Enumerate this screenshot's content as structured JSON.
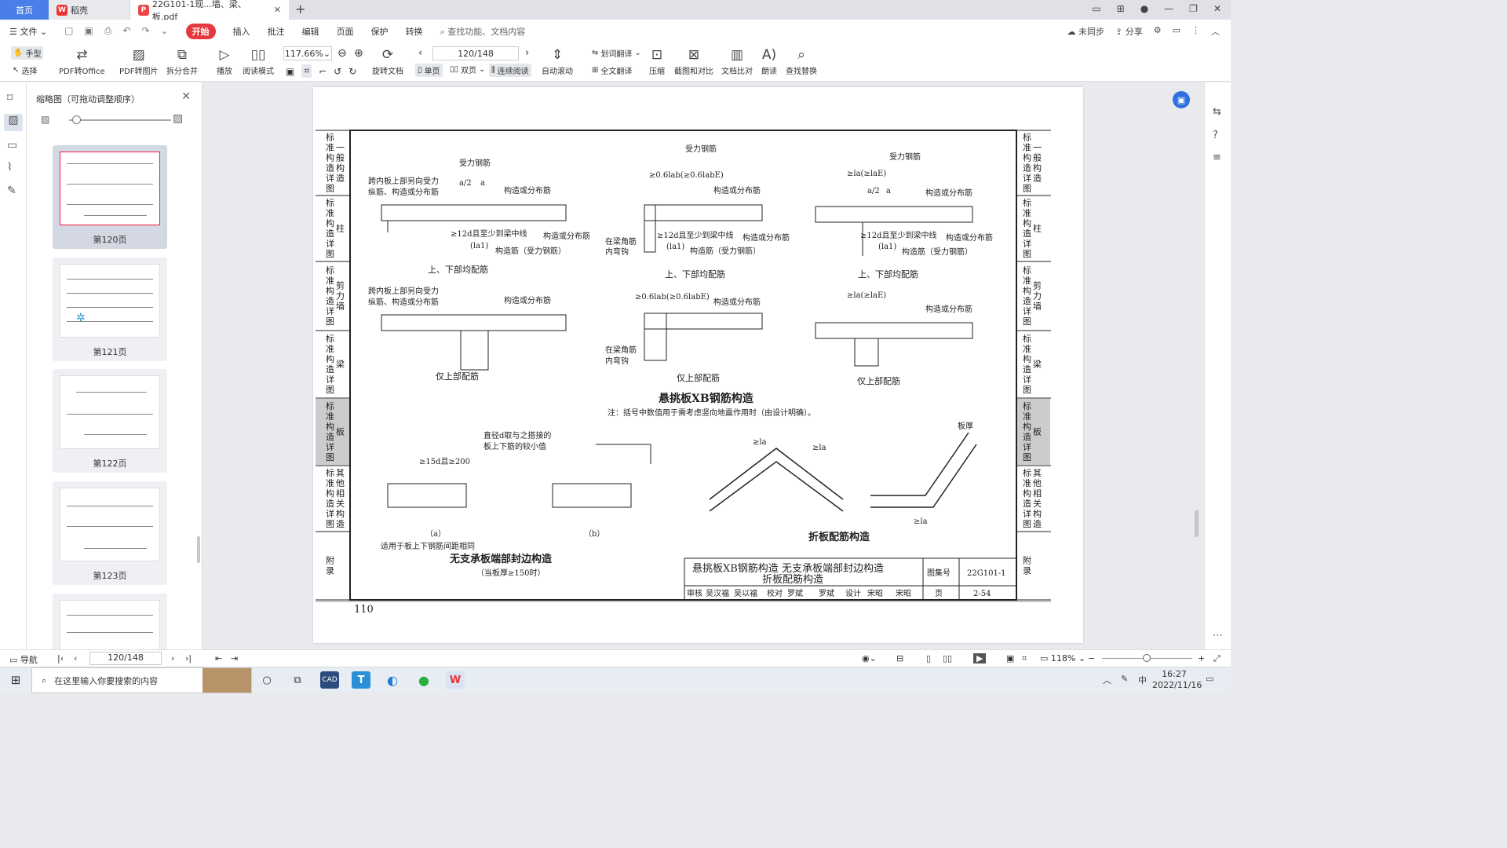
{
  "tabs": {
    "home": "首页",
    "docer": "稻壳",
    "pdf": "22G101-1现...墙、梁、板.pdf"
  },
  "menu": {
    "file": "文件",
    "start": "开始",
    "items": [
      "插入",
      "批注",
      "编辑",
      "页面",
      "保护",
      "转换"
    ],
    "search": "查找功能、文档内容",
    "unsync": "未同步",
    "share": "分享"
  },
  "ribbon": {
    "hand": "手型",
    "select": "选择",
    "pdf_to_office": "PDF转Office",
    "pdf_to_image": "PDF转图片",
    "split_merge": "拆分合并",
    "play": "播放",
    "read_mode": "阅读模式",
    "zoom": "117.66%",
    "page_input": "120/148",
    "rotate": "旋转文档",
    "single": "单页",
    "double": "双页",
    "continuous": "连续阅读",
    "auto_scroll": "自动滚动",
    "word_translate": "划词翻译",
    "full_translate": "全文翻译",
    "compress": "压缩",
    "screenshot_compare": "截图和对比",
    "doc_compare": "文档比对",
    "read_aloud": "朗读",
    "find_replace": "查找替换"
  },
  "thumbpanel": {
    "title": "缩略图（可拖动调整顺序）",
    "pages": [
      "第120页",
      "第121页",
      "第122页",
      "第123页"
    ]
  },
  "drawing": {
    "left_tabs": [
      [
        "标",
        "准",
        "构",
        "造",
        "详",
        "图"
      ],
      [
        "标",
        "准",
        "构",
        "造",
        "详",
        "图"
      ],
      [
        "标",
        "准",
        "构",
        "造",
        "详",
        "图"
      ],
      [
        "标",
        "准",
        "构",
        "造",
        "详",
        "图"
      ],
      [
        "标",
        "准",
        "构",
        "造",
        "详",
        "图"
      ],
      [
        "标",
        "准",
        "构",
        "造",
        "详",
        "图"
      ],
      [
        "附",
        "录"
      ]
    ],
    "left_tab_side": [
      "一般构造",
      "柱",
      "剪力墙",
      "梁",
      "板",
      "其他相关构造",
      ""
    ],
    "right_tabs": [
      [
        "标",
        "准",
        "构",
        "造",
        "详",
        "图"
      ],
      [
        "标",
        "准",
        "构",
        "造",
        "详",
        "图"
      ],
      [
        "标",
        "准",
        "构",
        "造",
        "详",
        "图"
      ],
      [
        "标",
        "准",
        "构",
        "造",
        "详",
        "图"
      ],
      [
        "标",
        "准",
        "构",
        "造",
        "详",
        "图"
      ],
      [
        "标",
        "准",
        "构",
        "造",
        "详",
        "图"
      ],
      [
        "附",
        "录"
      ]
    ],
    "right_tab_side": [
      "一般构造",
      "柱",
      "剪力墙",
      "梁",
      "板",
      "其他相关构造",
      ""
    ],
    "rebar_main": "受力钢筋",
    "note_span_top": "跨内板上部另向受力",
    "note_span_top2": "纵筋、构造或分布筋",
    "construct_dist": "构造或分布筋",
    "construct_dist_force": "构造筋（受力钢筋）",
    "lap_12d": "≥12d且至少到梁中线",
    "la1": "(la1)",
    "up_down": "上、下部均配筋",
    "top_only": "仅上部配筋",
    "anchor_06": "≥0.6lab(≥0.6labE)",
    "anchor_la": "≥la(≥laE)",
    "beam_corner": "在梁角筋",
    "inner_hook": "内弯钩",
    "half_a": "a/2",
    "a": "a",
    "15d": "15d",
    "cantilever_title": "悬挑板XB钢筋构造",
    "cantilever_note": "注：括号中数值用于需考虑竖向地震作用时（由设计明确）。",
    "edge_note1": "直径d取与之搭接的",
    "edge_note2": "板上下筋的较小值",
    "edge_15d": "≥15d且≥200",
    "thickness": "板厚",
    "label_a": "（a）",
    "label_b": "（b）",
    "edge_apply": "适用于板上下钢筋间距相同",
    "edge_title": "无支承板端部封边构造",
    "edge_sub": "（当板厚≥150时）",
    "folded_title": "折板配筋构造",
    "la_small": "≥la",
    "title_block_line1": "悬挑板XB钢筋构造  无支承板端部封边构造",
    "title_block_line2": "折板配筋构造",
    "atlas_label": "图集号",
    "atlas_no": "22G101-1",
    "page_label": "页",
    "page_no": "2-54",
    "signoff": [
      "审核",
      "吴汉福",
      "吴以福",
      "校对",
      "罗斌",
      "罗斌",
      "设计",
      "宋昭",
      "宋昭"
    ],
    "page_number": "110"
  },
  "status": {
    "nav": "导航",
    "page": "120/148",
    "zoom": "118%"
  },
  "taskbar": {
    "search": "在这里输入你要搜索的内容",
    "ime": "中",
    "time": "16:27",
    "date": "2022/11/16"
  }
}
